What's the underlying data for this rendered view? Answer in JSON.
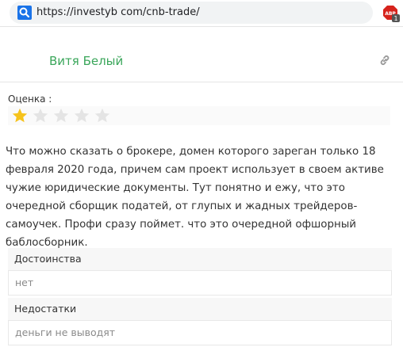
{
  "browser": {
    "url": "https://investyb com/cnb-trade/",
    "ext_badge": "1"
  },
  "review": {
    "author": "Витя Белый",
    "rating_label": "Оценка :",
    "rating": 1,
    "rating_max": 5,
    "text": "Что можно сказать о брокере, домен которого зареган только 18 февраля 2020 года, причем сам проект использует в своем активе чужие юридические документы. Тут понятно и ежу, что это очередной сборщик податей, от глупых и жадных трейдеров-самоучек. Профи сразу поймет. что это очередной офшорный баблосборник.",
    "pros_label": "Достоинства",
    "pros_value": "нет",
    "cons_label": "Недостатки",
    "cons_value": "деньги не выводят"
  },
  "colors": {
    "author": "#3aa65a",
    "star_filled": "#f6c31c",
    "star_empty": "#e4e4e4"
  }
}
